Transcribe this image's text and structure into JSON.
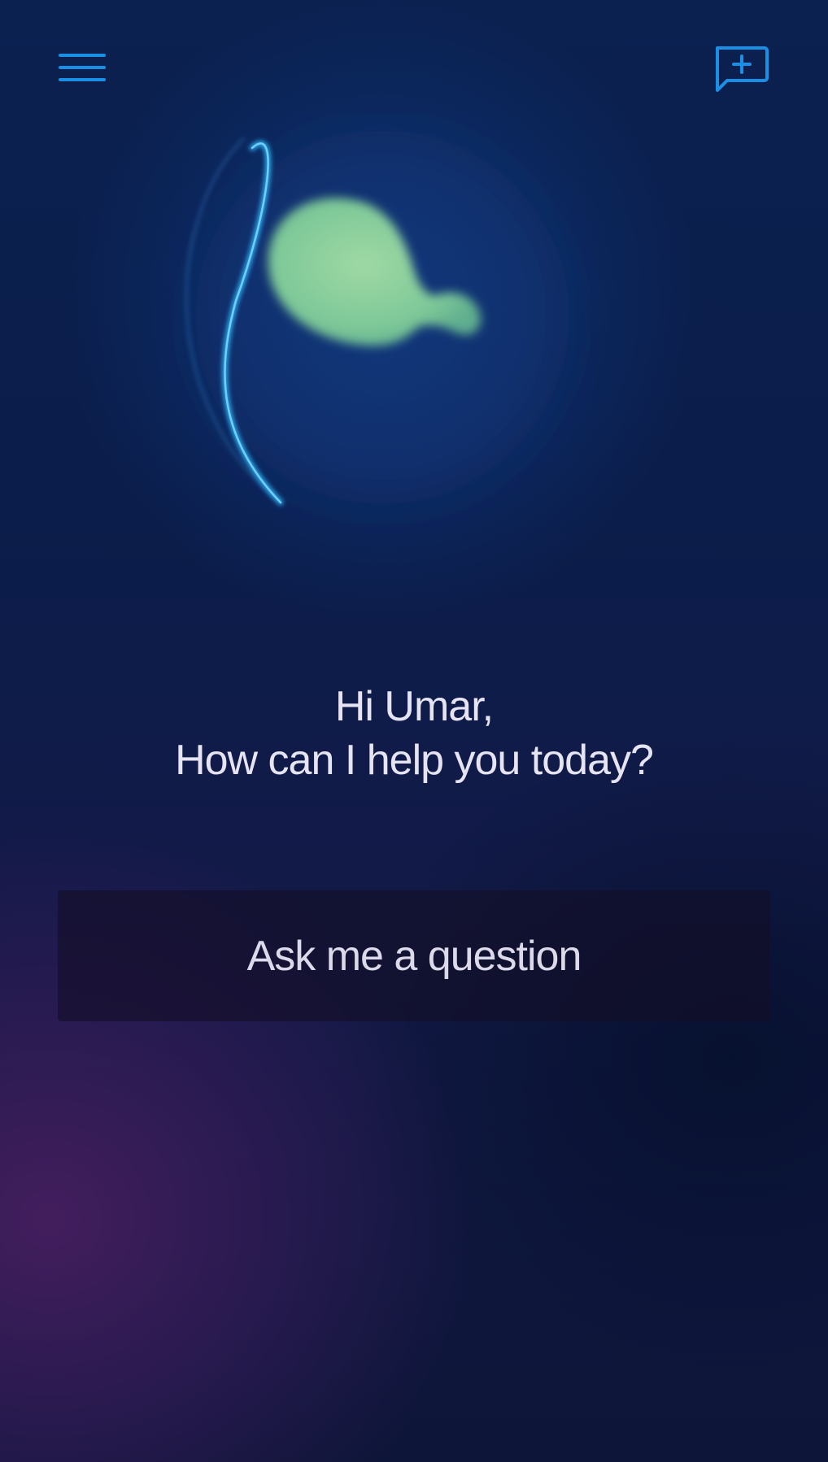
{
  "header": {
    "menu_icon": "hamburger-menu-icon",
    "compose_icon": "new-chat-plus-bubble-icon",
    "accent_color": "#1a8fe3"
  },
  "assistant": {
    "avatar_icon": "assistant-orb-logo"
  },
  "greeting": {
    "line1": "Hi Umar,",
    "line2": "How can I help you today?"
  },
  "ask": {
    "label": "Ask me a question"
  }
}
